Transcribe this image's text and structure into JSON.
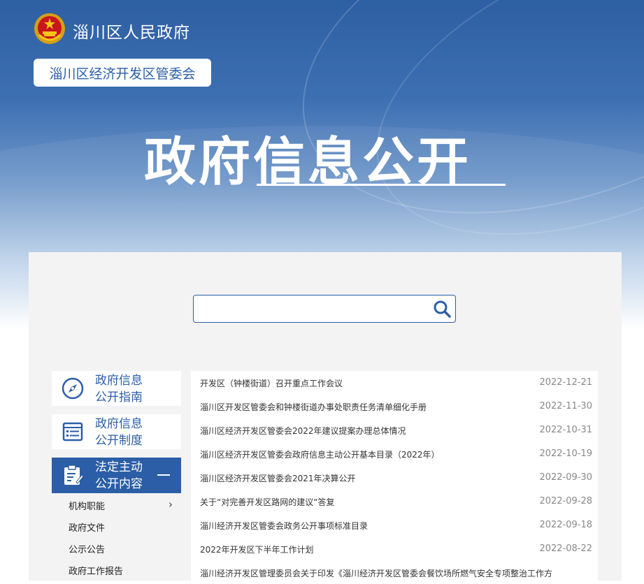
{
  "header": {
    "site_title": "淄川区人民政府",
    "department": "淄川区经济开发区管委会",
    "page_title": "政府信息公开"
  },
  "search": {
    "value": "",
    "placeholder": ""
  },
  "sidebar": {
    "items": [
      {
        "label_line1": "政府信息",
        "label_line2": "公开指南",
        "icon": "compass-icon"
      },
      {
        "label_line1": "政府信息",
        "label_line2": "公开制度",
        "icon": "list-icon"
      },
      {
        "label_line1": "法定主动",
        "label_line2": "公开内容",
        "icon": "clipboard-edit-icon",
        "active": true
      }
    ],
    "subitems": [
      "机构职能",
      "政府文件",
      "公示公告",
      "政府工作报告"
    ]
  },
  "news": [
    {
      "title": "开发区（钟楼街道）召开重点工作会议",
      "date": "2022-12-21"
    },
    {
      "title": "淄川区开发区管委会和钟楼街道办事处职责任务清单细化手册",
      "date": "2022-11-30"
    },
    {
      "title": "淄川区经济开发区管委会2022年建议提案办理总体情况",
      "date": "2022-10-31"
    },
    {
      "title": "淄川区经济开发区管委会政府信息主动公开基本目录（2022年）",
      "date": "2022-10-19"
    },
    {
      "title": "淄川区经济开发区管委会2021年决算公开",
      "date": "2022-09-30"
    },
    {
      "title": "关于“对完善开发区路网的建议“答复",
      "date": "2022-09-28"
    },
    {
      "title": "淄川经济开发区管委会政务公开事项标准目录",
      "date": "2022-09-18"
    },
    {
      "title": "2022年开发区下半年工作计划",
      "date": "2022-08-22"
    },
    {
      "title": "淄川经济开发区管理委员会关于印发《淄川经济开发区管委会餐饮场所燃气安全专项整治工作方",
      "date": ""
    }
  ],
  "colors": {
    "brand_blue": "#2b5ea7",
    "date_gray": "#888888",
    "panel_bg": "#f3f3f3"
  }
}
